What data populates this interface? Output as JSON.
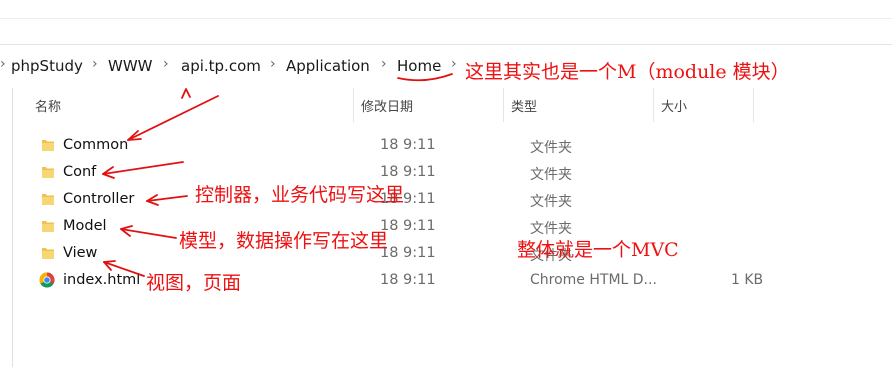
{
  "breadcrumb": [
    "phpStudy",
    "WWW",
    "api.tp.com",
    "Application",
    "Home"
  ],
  "headers": {
    "name": "名称",
    "date": "修改日期",
    "type": "类型",
    "size": "大小"
  },
  "files": [
    {
      "name": "Common",
      "date": "18 9:11",
      "type": "文件夹",
      "size": "",
      "icon": "folder-icon"
    },
    {
      "name": "Conf",
      "date": "18 9:11",
      "type": "文件夹",
      "size": "",
      "icon": "folder-icon"
    },
    {
      "name": "Controller",
      "date": "18 9:11",
      "type": "文件夹",
      "size": "",
      "icon": "folder-icon"
    },
    {
      "name": "Model",
      "date": "18 9:11",
      "type": "文件夹",
      "size": "",
      "icon": "folder-icon"
    },
    {
      "name": "View",
      "date": "18 9:11",
      "type": "文件夹",
      "size": "",
      "icon": "folder-icon"
    },
    {
      "name": "index.html",
      "date": "18 9:11",
      "type": "Chrome HTML D...",
      "size": "1 KB",
      "icon": "chrome-icon"
    }
  ],
  "annotations": {
    "home": "这里其实也是一个M（module 模块）",
    "controller": "控制器，业务代码写这里",
    "model": "模型，数据操作写在这里",
    "mvc": "整体就是一个MVC",
    "view": "视图，页面"
  },
  "colors": {
    "annotation": "#e11111",
    "folder": "#f2c14e"
  }
}
